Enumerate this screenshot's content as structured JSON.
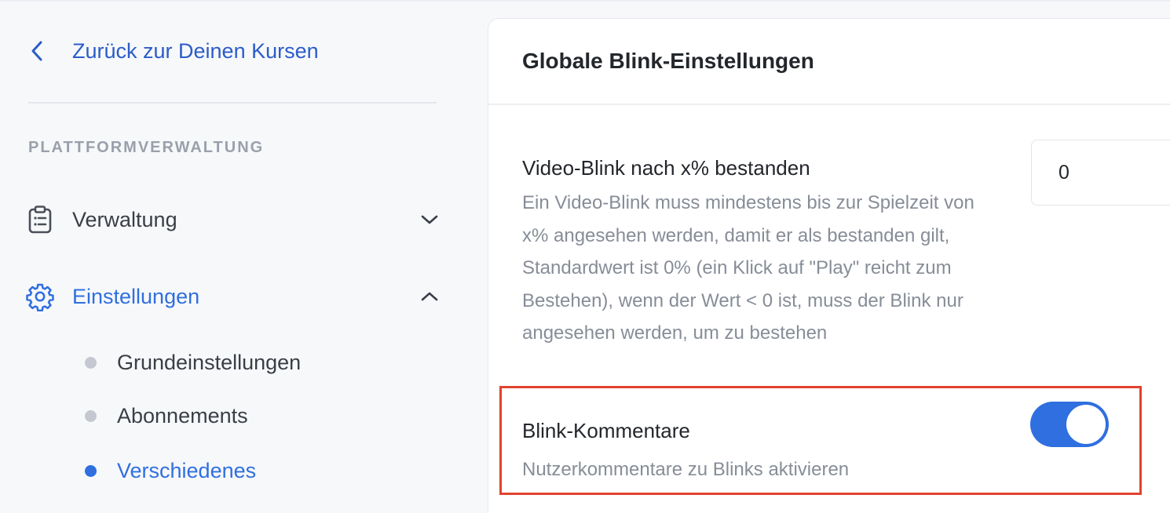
{
  "sidebar": {
    "back_link": "Zurück zur Deinen Kursen",
    "section_heading": "PLATTFORMVERWALTUNG",
    "nav": {
      "verwaltung": {
        "label": "Verwaltung",
        "icon": "clipboard-list-icon",
        "expanded": false
      },
      "einstellungen": {
        "label": "Einstellungen",
        "icon": "gear-icon",
        "expanded": true
      }
    },
    "sub_items": [
      {
        "label": "Grundeinstellungen",
        "active": false
      },
      {
        "label": "Abonnements",
        "active": false
      },
      {
        "label": "Verschiedenes",
        "active": true
      }
    ]
  },
  "card": {
    "title": "Globale Blink-Einstellungen",
    "video_setting": {
      "title": "Video-Blink nach x% bestanden",
      "description": "Ein Video-Blink muss mindestens bis zur Spielzeit von x% angesehen werden, damit er als bestanden gilt, Standardwert ist 0% (ein Klick auf \"Play\" reicht zum Bestehen), wenn der Wert < 0 ist, muss der Blink nur angesehen werden, um zu bestehen",
      "value": "0"
    },
    "comments_setting": {
      "title": "Blink-Kommentare",
      "description": "Nutzerkommentare zu Blinks aktivieren",
      "enabled": true
    }
  },
  "colors": {
    "accent": "#2f6fdf",
    "link": "#2b5cc9",
    "highlight": "#e0432f",
    "muted_text": "#878d97"
  }
}
